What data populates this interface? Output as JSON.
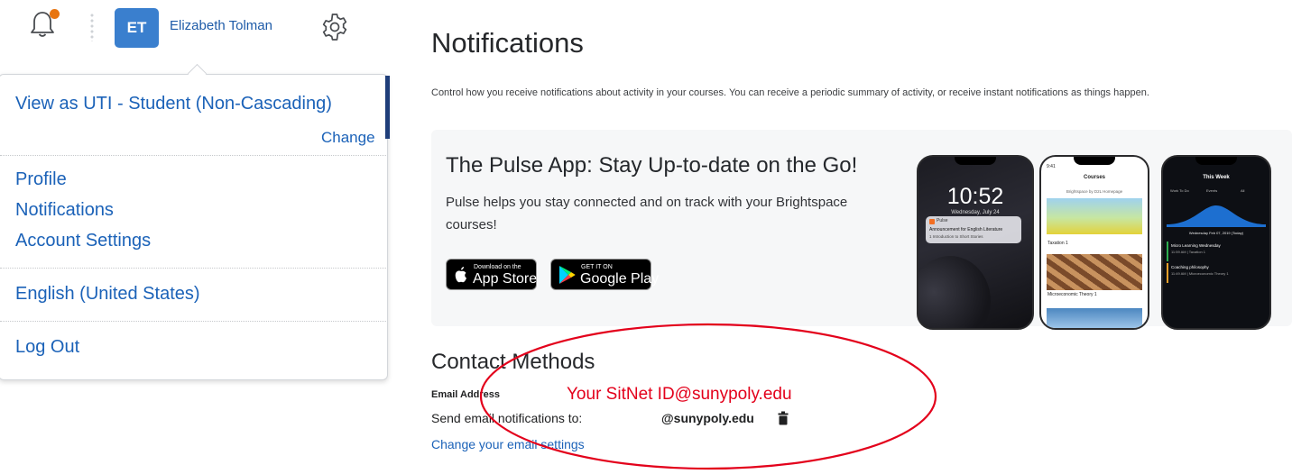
{
  "header": {
    "avatar_initials": "ET",
    "user_name": "Elizabeth Tolman",
    "notification_dot_color": "#e87511",
    "icons": [
      "bell-icon",
      "gear-icon"
    ]
  },
  "menu": {
    "role_label": "View as UTI - Student (Non-Cascading)",
    "change_label": "Change",
    "items": [
      "Profile",
      "Notifications",
      "Account Settings"
    ],
    "language": "English (United States)",
    "logout": "Log Out"
  },
  "page": {
    "title": "Notifications",
    "description": "Control how you receive notifications about activity in your courses. You can receive a periodic summary of activity, or receive instant notifications as things happen."
  },
  "pulse_banner": {
    "title": "The Pulse App: Stay Up-to-date on the Go!",
    "description": "Pulse helps you stay connected and on track with your Brightspace courses!",
    "app_store_small": "Download on the",
    "app_store_big": "App Store",
    "google_play_small": "GET IT ON",
    "google_play_big": "Google Play",
    "phone1": {
      "time": "10:52",
      "date": "Wednesday, July 24",
      "notif_title": "Pulse",
      "notif_text": "Announcement for English Literature",
      "notif_sub": "1 Introduction to Short Stories"
    },
    "phone2": {
      "status_time": "9:41",
      "header": "Courses",
      "subheader": "Brightspace by D2L Homepage",
      "course1": "Taxation 1",
      "course2": "Microeconomic Theory 1"
    },
    "phone3": {
      "header": "This Week",
      "tabs": [
        "Work To Do",
        "Events",
        "All"
      ],
      "date_row": "Wednesday Feb 07, 2019 (Today)",
      "item1_title": "Micro Learning Wednesday",
      "item1_sub": "11:59 AM | Taxation 1",
      "item2_title": "Coaching philosophy",
      "item2_sub": "11:49 AM | Microeconomic Theory 1"
    }
  },
  "contact": {
    "title": "Contact Methods",
    "email_label": "Email Address",
    "send_label": "Send email notifications to:",
    "email_value": "@sunypoly.edu",
    "change_link": "Change your email settings"
  },
  "annotation": {
    "text": "Your SitNet ID@sunypoly.edu",
    "color": "#e3001b"
  }
}
